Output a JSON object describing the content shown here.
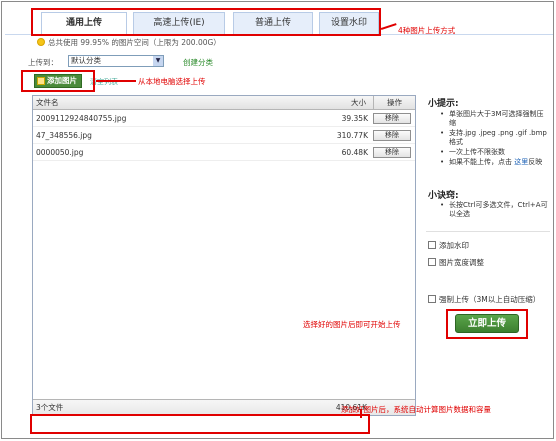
{
  "tabs": [
    {
      "label": "通用上传",
      "active": true
    },
    {
      "label": "高速上传(IE)",
      "active": false
    },
    {
      "label": "普通上传",
      "active": false
    },
    {
      "label": "设置水印",
      "active": false
    }
  ],
  "usage_text": "总共使用  99.95% 的图片空间（上限为 200.00G）",
  "upload_to": {
    "label": "上传到：",
    "selected": "默认分类",
    "create_link": "创建分类"
  },
  "add_button": "添加图片",
  "clear_list": "清空列表",
  "table": {
    "headers": {
      "name": "文件名",
      "size": "大小",
      "action": "操作"
    },
    "rows": [
      {
        "name": "2009112924840755.jpg",
        "size": "39.35K",
        "action": "移除"
      },
      {
        "name": "47_348556.jpg",
        "size": "310.77K",
        "action": "移除"
      },
      {
        "name": "0000050.jpg",
        "size": "60.48K",
        "action": "移除"
      }
    ],
    "footer": {
      "count": "3个文件",
      "total": "410.61K"
    }
  },
  "tips": {
    "title": "小提示:",
    "items": [
      "单张图片大于3M可选择强制压缩",
      "支持.jpg .jpeg .png .gif .bmp格式",
      "一次上传不限张数",
      "如果不能上传，点击这里反映"
    ],
    "link_text": "这里"
  },
  "tricks": {
    "title": "小诀窍:",
    "items": [
      "长按Ctrl可多选文件，Ctrl+A可以全选"
    ]
  },
  "options": {
    "watermark": "添加水印",
    "resize": "图片宽度调整",
    "force": "强制上传（3M以上自动压缩）"
  },
  "start_button": "立即上传",
  "annotations": {
    "tabs": "4种图片上传方式",
    "add": "从本地电脑选择上传",
    "start": "选择好的图片后即可开始上传",
    "footer": "添加好图片后，系统自动计算图片数据和容量"
  },
  "colors": {
    "accent_green": "#4a8a3a",
    "annotation_red": "#e00000",
    "tab_blue": "#e6eefa"
  }
}
